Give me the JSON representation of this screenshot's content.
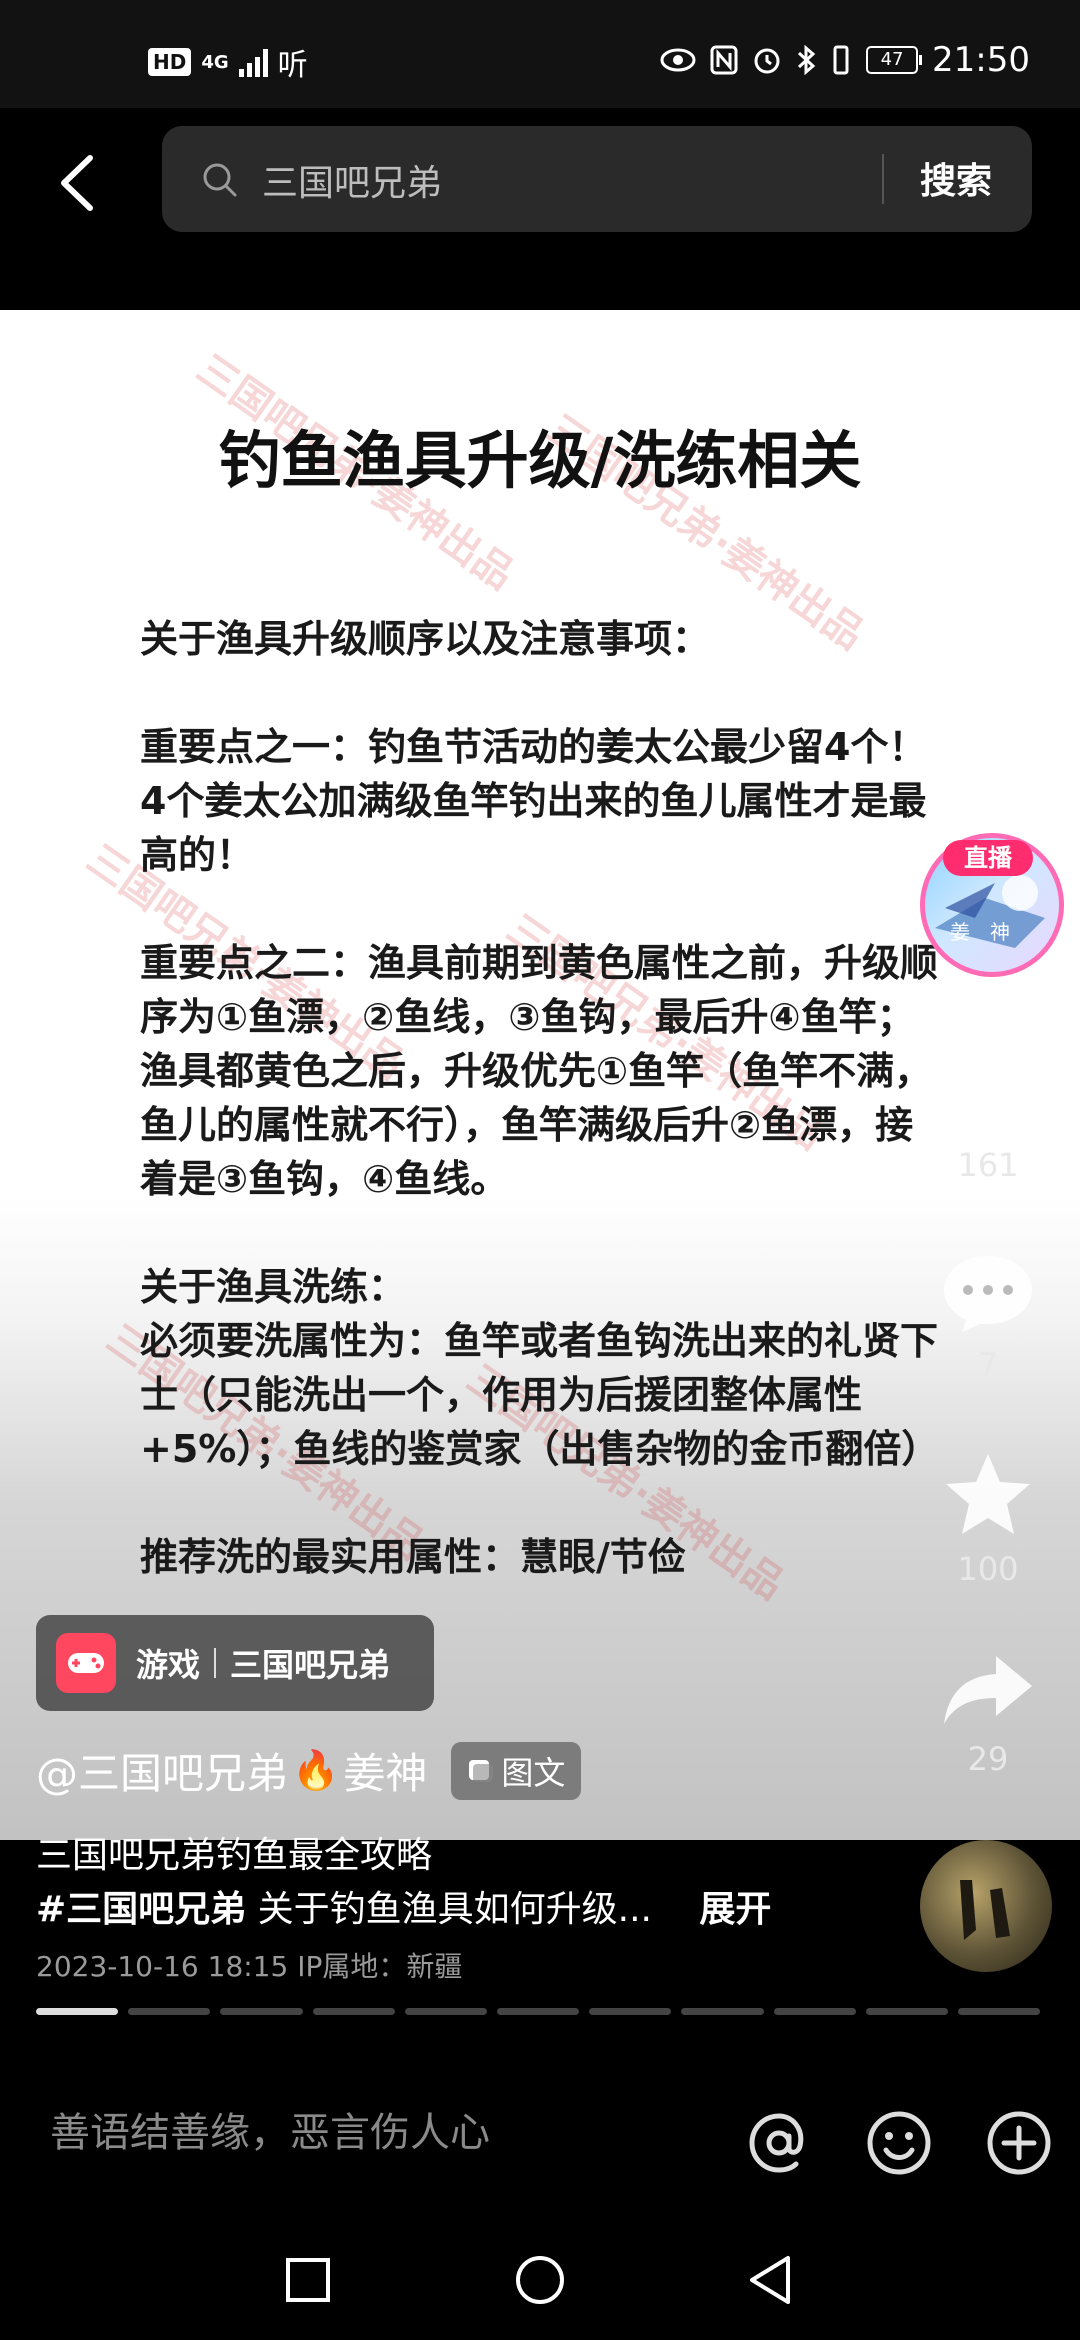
{
  "status_bar": {
    "hd_label": "HD",
    "network_label": "4G",
    "audio_label": "听",
    "battery_level": "47",
    "time": "21:50"
  },
  "search": {
    "query": "三国吧兄弟",
    "button_label": "搜索"
  },
  "post": {
    "title": "钓鱼渔具升级/洗练相关",
    "paragraphs": [
      "关于渔具升级顺序以及注意事项：",
      "重要点之一：钓鱼节活动的姜太公最少留4个！4个姜太公加满级鱼竿钓出来的鱼儿属性才是最高的！",
      "重要点之二：渔具前期到黄色属性之前，升级顺序为①鱼漂，②鱼线，③鱼钩，最后升④鱼竿；渔具都黄色之后，升级优先①鱼竿（鱼竿不满，鱼儿的属性就不行），鱼竿满级后升②鱼漂，接着是③鱼钩，④鱼线。",
      "关于渔具洗练：",
      "必须要洗属性为：鱼竿或者鱼钩洗出来的礼贤下士（只能洗出一个，作用为后援团整体属性+5%）；鱼线的鉴赏家（出售杂物的金币翻倍）",
      "推荐洗的最实用属性：慧眼/节俭"
    ],
    "watermark": "三国吧兄弟·姜神出品"
  },
  "live": {
    "badge": "直播",
    "caption": "姜神"
  },
  "actions": {
    "likes": "161",
    "comments": "7",
    "favorites": "100",
    "shares": "29"
  },
  "tag": {
    "category": "游戏",
    "topic": "三国吧兄弟"
  },
  "author": {
    "name": "@三国吧兄弟",
    "name_suffix": "姜神",
    "type_label": "图文"
  },
  "caption": {
    "title": "三国吧兄弟钓鱼最全攻略",
    "hashtag": "#三国吧兄弟",
    "text": "关于钓鱼渔具如何升级...",
    "expand": "展开",
    "meta": "2023-10-16 18:15 IP属地：新疆"
  },
  "progress": {
    "total_pages": 11,
    "current_page": 1
  },
  "comment_bar": {
    "placeholder": "善语结善缘，恶言伤人心"
  },
  "colors": {
    "accent_live": "#ff2d6f",
    "game_icon": "#ff4760",
    "background": "#000000"
  }
}
